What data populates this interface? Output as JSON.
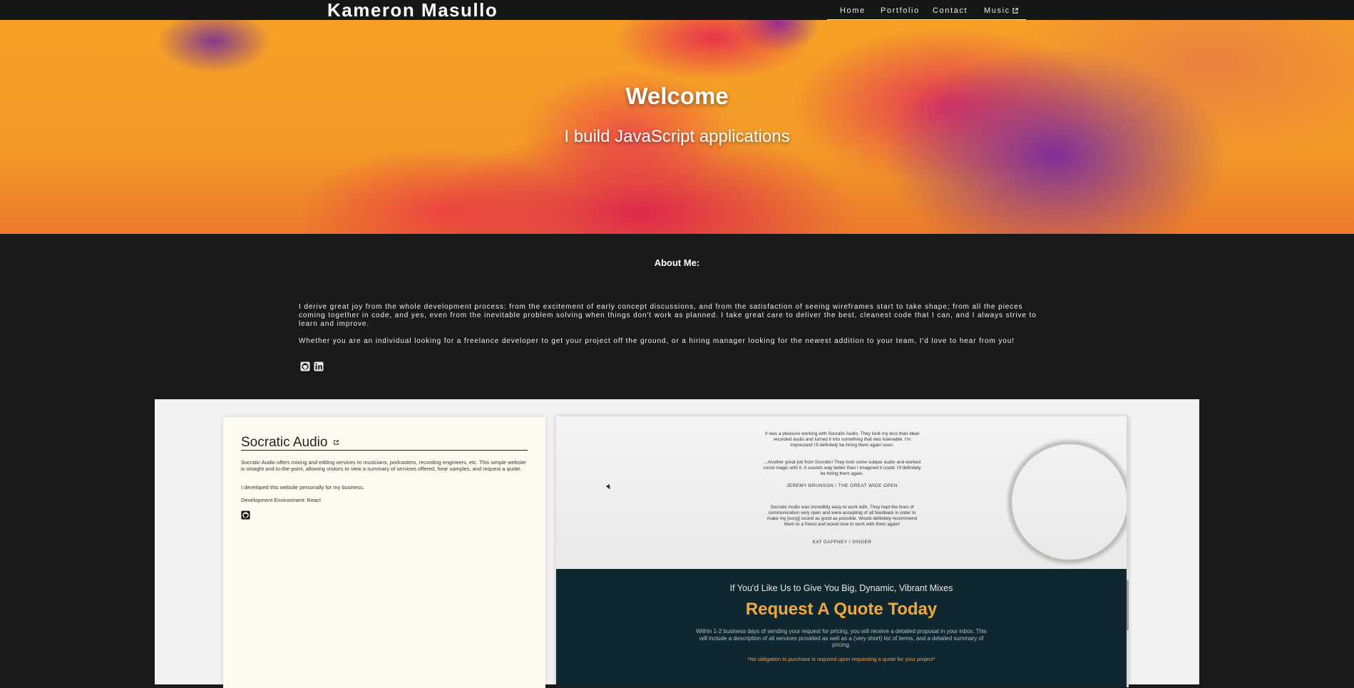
{
  "nav": {
    "brand": "Kameron Masullo",
    "links": [
      {
        "label": "Home"
      },
      {
        "label": "Portfolio"
      },
      {
        "label": "Contact"
      },
      {
        "label": "Music",
        "icon": "external-link-icon"
      }
    ]
  },
  "hero": {
    "title": "Welcome",
    "subtitle": "I build JavaScript applications"
  },
  "about": {
    "title": "About Me:",
    "paragraphs": [
      "I derive great joy from the whole development process: from the excitement of early concept discussions, and from the satisfaction of seeing wireframes start to take shape; from all the pieces coming together in code, and yes, even from the inevitable problem solving when things don't work as planned. I take great care to deliver the best, cleanest code that I can, and I always strive to learn and improve.",
      "Whether you are an individual looking for a freelance developer to get your project off the ground, or a hiring manager looking for the newest addition to your team, I'd love to hear from you!"
    ],
    "social_icons": [
      "github-icon",
      "linkedin-icon"
    ]
  },
  "portfolio": {
    "project": {
      "title": "Socratic Audio",
      "description": "Socratic Audio offers mixing and editing services to musicians, podcasters, recording engineers, etc. This simple website is straight and to-the-point, allowing visitors to view a summary of services offered, hear samples, and request a quote.",
      "note": "I developed this website personally for my business.",
      "environment": "Development Environment: React",
      "icon": "github-icon"
    },
    "preview": {
      "testimonials": [
        {
          "text": "It was a pleasure working with Socratic Audio. They took my less than ideal recorded audio and turned it into something that was listenable. I'm impressed! I'll definitely be hiring them again soon.",
          "name": ""
        },
        {
          "text": "...Another great job from Socratic! They took some subpar audio and worked some magic with it. It sounds way better than I imagined it could. I'll definitely be hiring them again.",
          "name": "JEREMY BRUNSON / THE GREAT WIDE OPEN"
        },
        {
          "text": "Socratic Audio was incredibly easy to work with. They kept the lines of communication very open and were accepting of all feedback in order to make my [song] sound as good as possible. Would definitely recommend them to a friend and would love to work with them again!",
          "name": "KAT GAFFNEY / SINGER"
        }
      ],
      "cta_subtitle": "If You'd Like Us to Give You Big, Dynamic, Vibrant Mixes",
      "cta_title": "Request A Quote Today",
      "cta_text": "Within 1-2 business days of sending your request for pricing, you will receive a detailed proposal in your inbox. This will include a description of all services provided as well as a (very short) list of terms, and a detailed summary of pricing.",
      "cta_note": "*No obligation to purchase is required upon requesting a quote for your project*"
    }
  },
  "colors": {
    "nav_bg": "#161616",
    "page_bg": "#1a1a1a",
    "hero_orange": "#f6a126",
    "card_bg": "#fdfbf0",
    "cta_bg": "#112730",
    "cta_accent": "#f2a93b"
  }
}
